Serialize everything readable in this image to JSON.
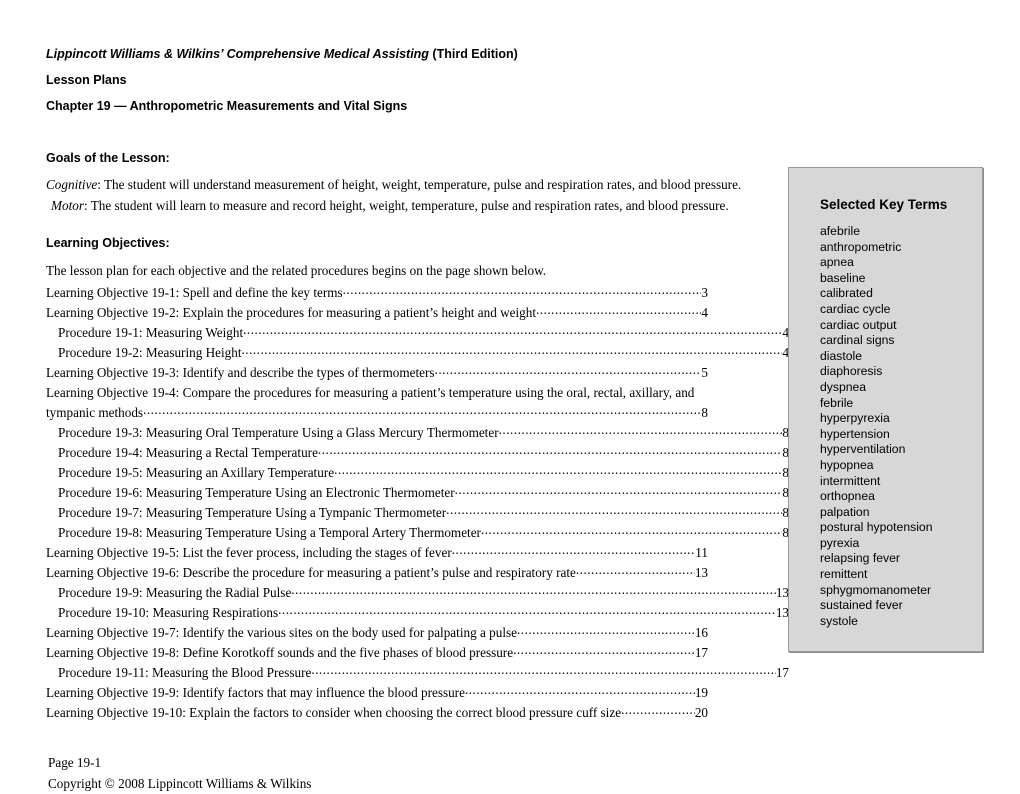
{
  "document": {
    "book_title_italic": "Lippincott Williams & Wilkins’ Comprehensive Medical Assisting",
    "edition": " (Third Edition)",
    "doc_type": "Lesson Plans",
    "chapter_title": "Chapter 19 — Anthropometric Measurements and Vital Signs"
  },
  "goals": {
    "heading": "Goals of the Lesson:",
    "cognitive_label": "Cognitive",
    "cognitive_text": ": The student will understand measurement of height, weight, temperature, pulse and respiration rates, and blood pressure.",
    "motor_label": "Motor",
    "motor_text": ": The student will learn to measure and record height, weight, temperature, pulse and respiration rates, and blood pressure."
  },
  "learning_objectives": {
    "heading": "Learning Objectives:",
    "intro": "The lesson plan for each objective and the related procedures begins on the page shown below.",
    "entries": [
      {
        "type": "objective",
        "label": "Learning Objective 19-1: Spell and define the key terms",
        "page": "3"
      },
      {
        "type": "objective",
        "label": "Learning Objective 19-2:  Explain the procedures for measuring a patient’s height and weight",
        "page": "4"
      },
      {
        "type": "procedure",
        "label": "Procedure 19-1:  Measuring Weight",
        "page": "4"
      },
      {
        "type": "procedure",
        "label": "Procedure 19-2:  Measuring Height",
        "page": "4"
      },
      {
        "type": "objective",
        "label": "Learning Objective 19-3:  Identify and describe the types of thermometers",
        "page": "5"
      },
      {
        "type": "objective-wrap",
        "label_line1": "Learning Objective 19-4:  Compare the procedures for measuring a patient’s temperature using  the oral, rectal, axillary, and",
        "label_line2": "tympanic methods",
        "page": "8"
      },
      {
        "type": "procedure",
        "label": "Procedure 19-3:  Measuring Oral Temperature Using a Glass Mercury Thermometer",
        "page": "8"
      },
      {
        "type": "procedure",
        "label": "Procedure 19-4:  Measuring a Rectal Temperature",
        "page": "8"
      },
      {
        "type": "procedure",
        "label": "Procedure 19-5:  Measuring an Axillary Temperature",
        "page": "8"
      },
      {
        "type": "procedure",
        "label": "Procedure 19-6:  Measuring Temperature Using an Electronic Thermometer",
        "page": "8"
      },
      {
        "type": "procedure",
        "label": "Procedure 19-7:  Measuring Temperature Using a Tympanic Thermometer",
        "page": "8"
      },
      {
        "type": "procedure",
        "label": "Procedure 19-8:  Measuring Temperature Using a Temporal Artery Thermometer",
        "page": "8"
      },
      {
        "type": "objective",
        "label": "Learning Objective 19-5:  List the fever process, including the stages of fever",
        "page": "11"
      },
      {
        "type": "objective",
        "label": "Learning Objective 19-6:  Describe the procedure for measuring a patient’s pulse and respiratory rate",
        "page": "13"
      },
      {
        "type": "procedure",
        "label": "Procedure 19-9:  Measuring the Radial Pulse",
        "page": "13"
      },
      {
        "type": "procedure",
        "label": "Procedure 19-10:  Measuring Respirations",
        "page": "13"
      },
      {
        "type": "objective",
        "label": "Learning Objective 19-7:  Identify the various sites on the body used for palpating a pulse",
        "page": "16"
      },
      {
        "type": "objective",
        "label": "Learning Objective 19-8:  Define Korotkoff sounds and the five phases of blood pressure",
        "page": "17"
      },
      {
        "type": "procedure",
        "label": "Procedure 19-11:  Measuring the Blood Pressure",
        "page": "17"
      },
      {
        "type": "objective",
        "label": "Learning Objective 19-9:  Identify factors that may influence the blood pressure",
        "page": "19"
      },
      {
        "type": "objective",
        "label": "Learning Objective 19-10:  Explain the factors to consider when choosing the correct blood pressure cuff size",
        "page": "20"
      }
    ]
  },
  "key_terms": {
    "title": "Selected Key Terms",
    "terms": [
      "afebrile",
      "anthropometric",
      "apnea",
      "baseline",
      "calibrated",
      "cardiac cycle",
      "cardiac output",
      "cardinal signs",
      "diastole",
      "diaphoresis",
      "dyspnea",
      "febrile",
      "hyperpyrexia",
      "hypertension",
      "hyperventilation",
      "hypopnea",
      "intermittent",
      "orthopnea",
      "palpation",
      "postural hypotension",
      "pyrexia",
      "relapsing fever",
      "remittent",
      "sphygmomanometer",
      "sustained fever",
      "systole"
    ],
    "background_color": "#d7d7d7",
    "border_color": "#9a9a9a"
  },
  "footer": {
    "page_label": "Page 19-1",
    "copyright": "Copyright © 2008 Lippincott Williams & Wilkins"
  }
}
